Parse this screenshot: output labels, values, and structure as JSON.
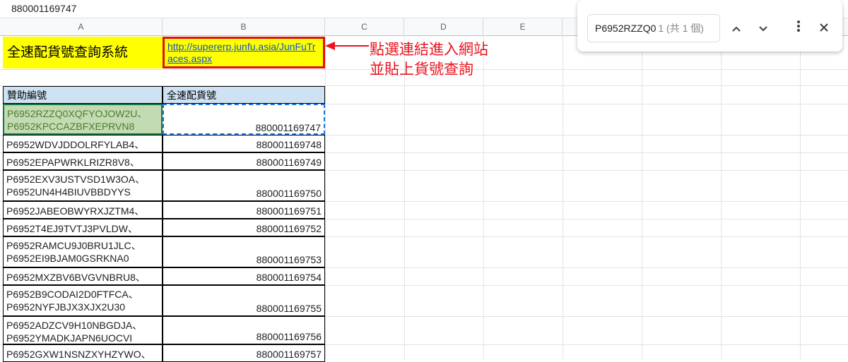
{
  "formula_bar": {
    "value": "880001169747"
  },
  "columns": [
    "A",
    "B",
    "C",
    "D",
    "E"
  ],
  "title_cell": "全速配貨號查詢系統",
  "link_cell": "http://supererp.junfu.asia/JunFuTraces.aspx",
  "annotation": {
    "line1": "點選連結進入網站",
    "line2": "並貼上貨號查詢"
  },
  "table": {
    "header_a": "贊助編號",
    "header_b": "全速配貨號",
    "rows": [
      {
        "a1": "P6952RZZQ0XQFYOJOW2U、",
        "a2": "P6952KPCCAZBFXEPRVN8",
        "b": "880001169747"
      },
      {
        "a1": "P6952WDVJDDOLRFYLAB4、",
        "a2": "",
        "b": "880001169748"
      },
      {
        "a1": "P6952EPAPWRKLRIZR8V8、",
        "a2": "",
        "b": "880001169749"
      },
      {
        "a1": "P6952EXV3USTVSD1W3OA、",
        "a2": "P6952UN4H4BIUVBBDYYS",
        "b": "880001169750"
      },
      {
        "a1": "P6952JABEOBWYRXJZTM4、",
        "a2": "",
        "b": "880001169751"
      },
      {
        "a1": "P6952T4EJ9TVTJ3PVLDW、",
        "a2": "",
        "b": "880001169752"
      },
      {
        "a1": "P6952RAMCU9J0BRU1JLC、",
        "a2": "P6952EI9BJAM0GSRKNA0",
        "b": "880001169753"
      },
      {
        "a1": "P6952MXZBV6BVGVNBRU8、",
        "a2": "",
        "b": "880001169754"
      },
      {
        "a1": "P6952B9CODAI2D0FTFCA、",
        "a2": "P6952NYFJBJX3XJX2U30",
        "b": "880001169755"
      },
      {
        "a1": "P6952ADZCV9H10NBGDJA、",
        "a2": "P6952YMADKJAPN6UOCVI",
        "b": "880001169756"
      },
      {
        "a1": "P6952GXW1NSNZXYHZYWO、",
        "a2": "",
        "b": "880001169757"
      }
    ]
  },
  "find": {
    "query": "P6952RZZQ0",
    "count": "1 (共 1 個)"
  },
  "icons": {
    "prev": "chevron-up-icon",
    "next": "chevron-down-icon",
    "more": "more-vert-icon",
    "close": "close-icon"
  },
  "colors": {
    "highlight": "#ffff00",
    "header_fill": "#cfe2f3",
    "selected_fill": "#c3dbb3",
    "annotation": "#e8141e",
    "link": "#1155cc"
  }
}
